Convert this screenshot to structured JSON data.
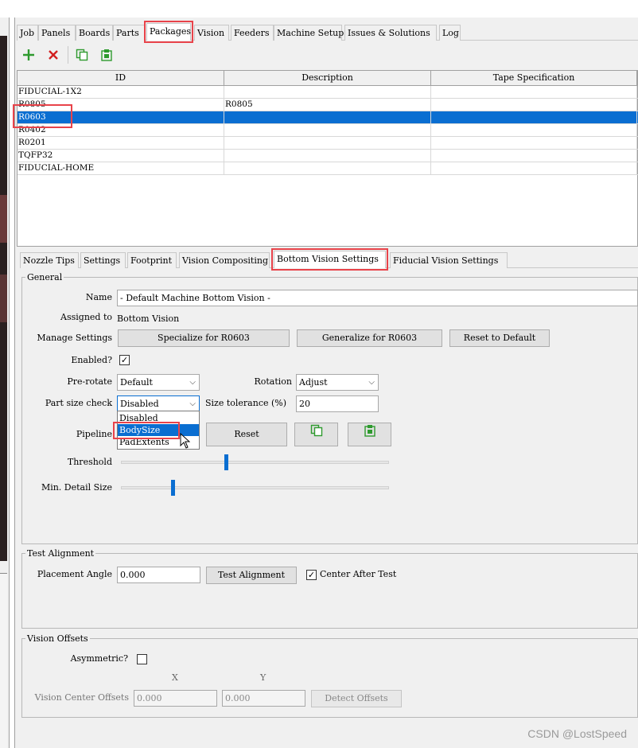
{
  "main_tabs": [
    {
      "label": "Job"
    },
    {
      "label": "Panels"
    },
    {
      "label": "Boards"
    },
    {
      "label": "Parts"
    },
    {
      "label": "Packages"
    },
    {
      "label": "Vision"
    },
    {
      "label": "Feeders"
    },
    {
      "label": "Machine Setup"
    },
    {
      "label": "Issues & Solutions"
    },
    {
      "label": "Log"
    }
  ],
  "active_main_tab": "Packages",
  "toolbar": {
    "icons": [
      "add-icon",
      "delete-icon",
      "copy-icon",
      "paste-icon"
    ],
    "colors": {
      "add": "#2e9a2e",
      "delete": "#d21f1f",
      "copy": "#2e9a2e",
      "paste": "#2e9a2e"
    }
  },
  "table": {
    "headers": [
      "ID",
      "Description",
      "Tape Specification"
    ],
    "rows": [
      {
        "id": "FIDUCIAL-1X2",
        "description": "",
        "tape": ""
      },
      {
        "id": "R0805",
        "description": "R0805",
        "tape": ""
      },
      {
        "id": "R0603",
        "description": "",
        "tape": ""
      },
      {
        "id": "R0402",
        "description": "",
        "tape": ""
      },
      {
        "id": "R0201",
        "description": "",
        "tape": ""
      },
      {
        "id": "TQFP32",
        "description": "",
        "tape": ""
      },
      {
        "id": "FIDUCIAL-HOME",
        "description": "",
        "tape": ""
      }
    ],
    "selected_row": "R0603"
  },
  "sub_tabs": [
    {
      "label": "Nozzle Tips"
    },
    {
      "label": "Settings"
    },
    {
      "label": "Footprint"
    },
    {
      "label": "Vision Compositing"
    },
    {
      "label": "Bottom Vision Settings"
    },
    {
      "label": "Fiducial Vision Settings"
    }
  ],
  "active_sub_tab": "Bottom Vision Settings",
  "general": {
    "title": "General",
    "name_label": "Name",
    "name_value": "- Default Machine Bottom Vision -",
    "assigned_label": "Assigned to",
    "assigned_value": "Bottom Vision",
    "manage_label": "Manage Settings",
    "specialize_btn": "Specialize for  R0603",
    "generalize_btn": "Generalize for R0603",
    "reset_default_btn": "Reset to Default",
    "enabled_label": "Enabled?",
    "enabled_checked": "✓",
    "prerotate_label": "Pre-rotate",
    "prerotate_value": "Default",
    "rotation_label": "Rotation",
    "rotation_value": "Adjust",
    "partsize_label": "Part size check",
    "partsize_value": "Disabled",
    "tolerance_label": "Size tolerance  (%)",
    "tolerance_value": "20",
    "pipeline_label": "Pipeline",
    "reset_btn": "Reset",
    "threshold_label": "Threshold",
    "threshold_level": 0.39,
    "min_detail_label": "Min. Detail Size",
    "min_detail_level": 0.19
  },
  "dropdown": {
    "options": [
      "Disabled",
      "BodySize",
      "PadExtents"
    ],
    "highlighted": "BodySize"
  },
  "test_alignment": {
    "title": "Test Alignment",
    "angle_label": "Placement Angle",
    "angle_value": "0.000",
    "test_btn": "Test Alignment",
    "center_label": "Center After Test",
    "center_checked": "✓"
  },
  "vision_offsets": {
    "title": "Vision Offsets",
    "asymmetric_label": "Asymmetric?",
    "x_label": "X",
    "y_label": "Y",
    "center_offsets_label": "Vision Center Offsets",
    "x_value": "0.000",
    "y_value": "0.000",
    "detect_btn": "Detect Offsets"
  },
  "watermark": "CSDN @LostSpeed",
  "colors": {
    "selection": "#0a6ed1",
    "highlight_box": "#e8434a",
    "slider": "#0a6ed1"
  }
}
